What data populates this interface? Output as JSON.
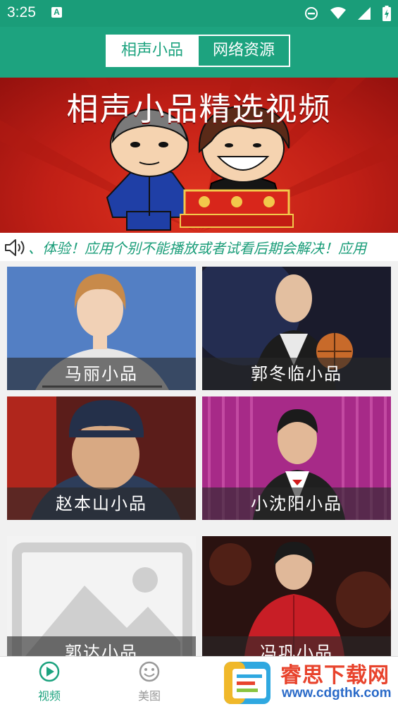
{
  "status_bar": {
    "time": "3:25",
    "notification_icon_letter": "A",
    "icons": [
      "dnd-icon",
      "wifi-icon",
      "signal-icon",
      "battery-charging-icon"
    ]
  },
  "header": {
    "tabs": [
      {
        "label": "相声小品",
        "active": true
      },
      {
        "label": "网络资源",
        "active": false
      }
    ],
    "accent_color": "#1da37f"
  },
  "banner": {
    "title": "相声小品精选视频"
  },
  "marquee": {
    "text": "、体验！应用个别不能播放或者试看后期会解决！应用"
  },
  "grid": {
    "items": [
      {
        "label": "马丽小品"
      },
      {
        "label": "郭冬临小品"
      },
      {
        "label": "赵本山小品"
      },
      {
        "label": "小沈阳小品"
      },
      {
        "label": "郭达小品"
      },
      {
        "label": "冯巩小品"
      }
    ]
  },
  "bottom_nav": {
    "items": [
      {
        "label": "视频",
        "icon": "play-circle-icon",
        "active": true
      },
      {
        "label": "美图",
        "icon": "face-icon",
        "active": false
      }
    ]
  },
  "watermark": {
    "site_name": "睿思下载网",
    "url": "www.cdgthk.com"
  }
}
